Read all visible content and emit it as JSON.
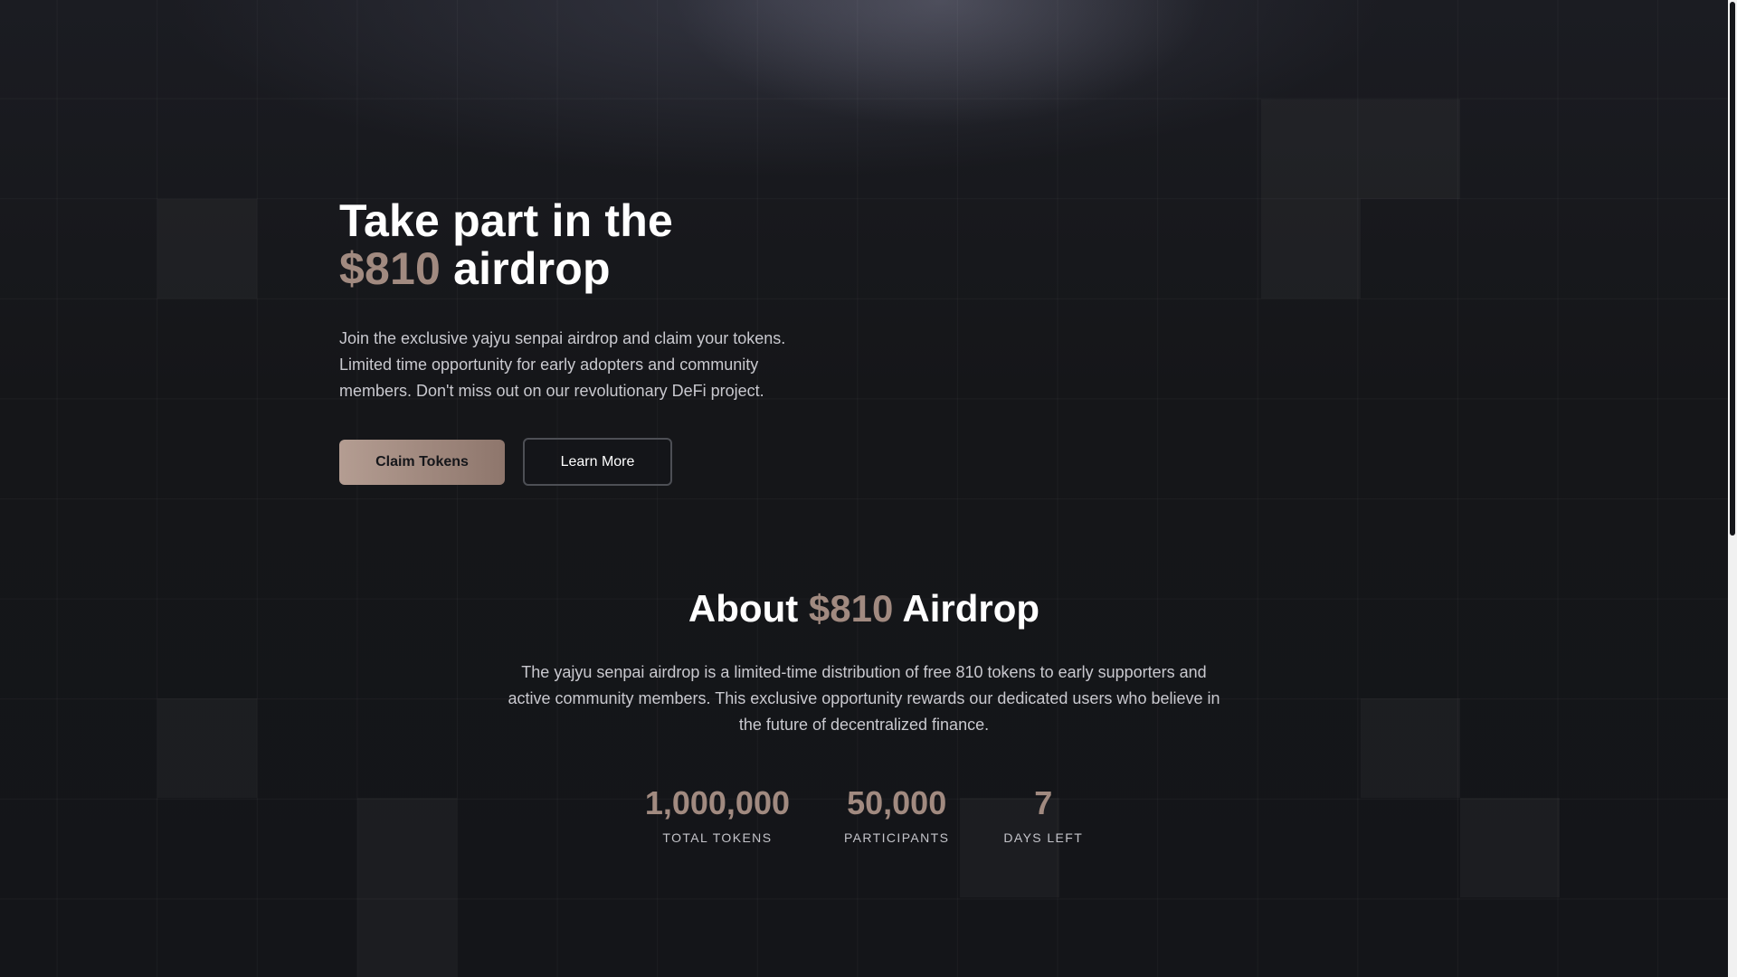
{
  "hero": {
    "title_line1": "Take part in the",
    "title_accent": "$810",
    "title_rest": " airdrop",
    "description": "Join the exclusive yajyu senpai airdrop and claim your tokens. Limited time opportunity for early adopters and community members. Don't miss out on our revolutionary DeFi project.",
    "primary_button": "Claim Tokens",
    "secondary_button": "Learn More"
  },
  "about": {
    "title_before": "About ",
    "title_accent": "$810",
    "title_after": " Airdrop",
    "description": "The yajyu senpai airdrop is a limited-time distribution of free 810 tokens to early supporters and active community members. This exclusive opportunity rewards our dedicated users who believe in the future of decentralized finance.",
    "stats": [
      {
        "value": "1,000,000",
        "label": "TOTAL TOKENS"
      },
      {
        "value": "50,000",
        "label": "PARTICIPANTS"
      },
      {
        "value": "7",
        "label": "DAYS LEFT"
      }
    ]
  },
  "colors": {
    "background": "#141519",
    "accent": "#a18a80",
    "text": "#ffffff",
    "muted_text": "#c9c9cf"
  }
}
